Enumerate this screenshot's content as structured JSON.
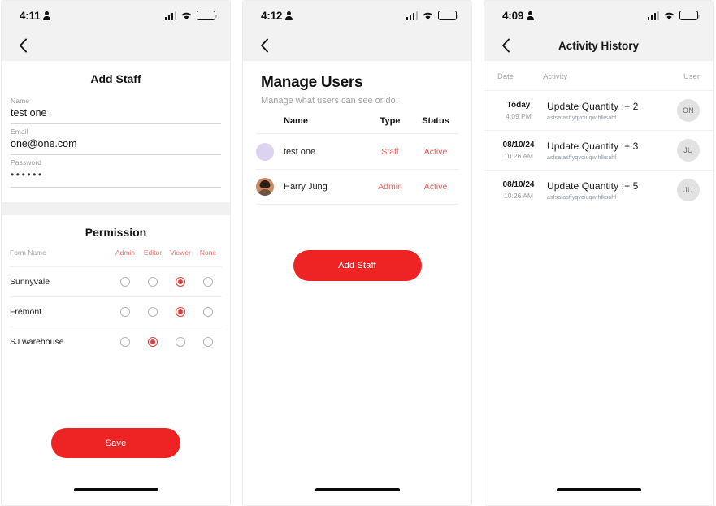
{
  "colors": {
    "accent_red": "#ee2424",
    "muted_red": "#e8605b",
    "header_bg": "#f2f2f2",
    "avatar_purple": "#ddd2f0",
    "badge_gray": "#e2e2e2"
  },
  "screen1": {
    "statusbar": {
      "time": "4:11"
    },
    "nav": {
      "back_icon": "chevron-left-icon"
    },
    "card_title": "Add Staff",
    "fields": [
      {
        "label": "Name",
        "value": "test one"
      },
      {
        "label": "Email",
        "value": "one@one.com"
      },
      {
        "label": "Password",
        "value": "••••••"
      }
    ],
    "permission": {
      "title": "Permission",
      "col_name_label": "Form Name",
      "columns": [
        "Admin",
        "Editor",
        "Viewer",
        "None"
      ],
      "rows": [
        {
          "name": "Sunnyvale",
          "selected": 2
        },
        {
          "name": "Fremont",
          "selected": 2
        },
        {
          "name": "SJ warehouse",
          "selected": 1
        }
      ]
    },
    "save_label": "Save"
  },
  "screen2": {
    "statusbar": {
      "time": "4:12"
    },
    "nav": {
      "back_icon": "chevron-left-icon"
    },
    "title": "Manage Users",
    "subtitle": "Manage what users can see or do.",
    "columns": {
      "name": "Name",
      "type": "Type",
      "status": "Status"
    },
    "users": [
      {
        "name": "test one",
        "type": "Staff",
        "status": "Active",
        "avatar": "placeholder-avatar"
      },
      {
        "name": "Harry Jung",
        "type": "Admin",
        "status": "Active",
        "avatar": "photo-avatar"
      }
    ],
    "add_staff_label": "Add Staff"
  },
  "screen3": {
    "statusbar": {
      "time": "4:09"
    },
    "nav": {
      "back_icon": "chevron-left-icon",
      "title": "Activity History"
    },
    "columns": {
      "date": "Date",
      "activity": "Activity",
      "user": "User"
    },
    "activities": [
      {
        "date": "Today",
        "time": "4:09 PM",
        "label": "Update Quantity :+ 2",
        "note": "asfsafasffyqyoiuqwlhlksahf",
        "user": "ON"
      },
      {
        "date": "08/10/24",
        "time": "10:26 AM",
        "label": "Update Quantity :+ 3",
        "note": "asfsafasffyqyoiuqwlhlksahf",
        "user": "JU"
      },
      {
        "date": "08/10/24",
        "time": "10:26 AM",
        "label": "Update Quantity :+ 5",
        "note": "asfsafasffyqyoiuqwlhlksahf",
        "user": "JU"
      }
    ]
  }
}
